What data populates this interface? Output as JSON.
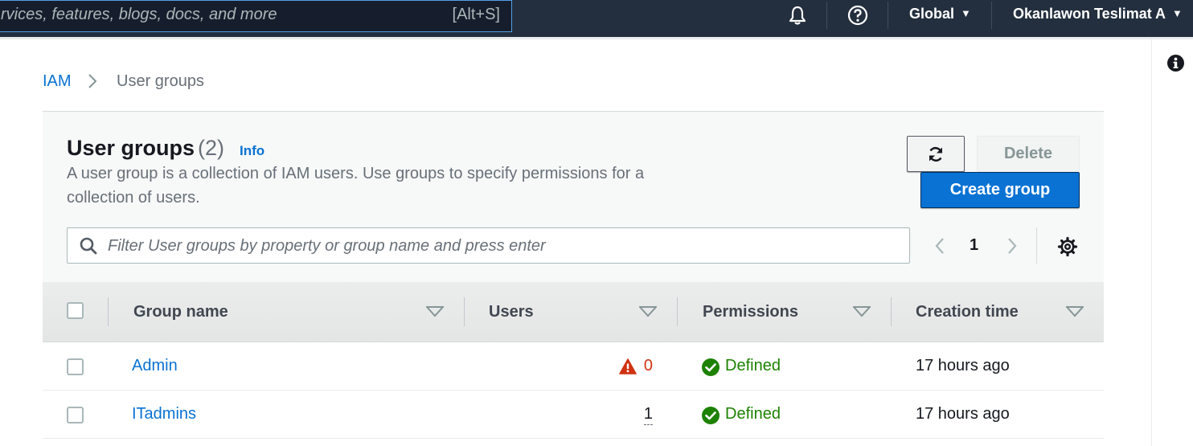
{
  "topnav": {
    "search_placeholder": "rvices, features, blogs, docs, and more",
    "search_shortcut": "[Alt+S]",
    "region": "Global",
    "account": "Okanlawon Teslimat A"
  },
  "breadcrumb": {
    "parent": "IAM",
    "current": "User groups"
  },
  "panel": {
    "title": "User groups",
    "count": "(2)",
    "info_link": "Info",
    "description": "A user group is a collection of IAM users. Use groups to specify permissions for a collection of users.",
    "delete_label": "Delete",
    "create_label": "Create group",
    "filter_placeholder": "Filter User groups by property or group name and press enter",
    "page_number": "1"
  },
  "table": {
    "columns": [
      "Group name",
      "Users",
      "Permissions",
      "Creation time"
    ],
    "rows": [
      {
        "name": "Admin",
        "users": "0",
        "users_warning": true,
        "permissions": "Defined",
        "created": "17 hours ago"
      },
      {
        "name": "ITadmins",
        "users": "1",
        "users_warning": false,
        "permissions": "Defined",
        "created": "17 hours ago"
      }
    ]
  },
  "colors": {
    "nav_bg": "#232f3e",
    "link": "#0972d3",
    "primary_button": "#0972d3",
    "success": "#1d8102",
    "warning": "#d13212"
  },
  "icons": [
    "bell-icon",
    "help-icon",
    "info-icon",
    "refresh-icon",
    "search-icon",
    "chevron-left-icon",
    "chevron-right-icon",
    "settings-gear-icon",
    "sort-caret-icon",
    "warning-triangle-icon",
    "check-circle-icon"
  ]
}
